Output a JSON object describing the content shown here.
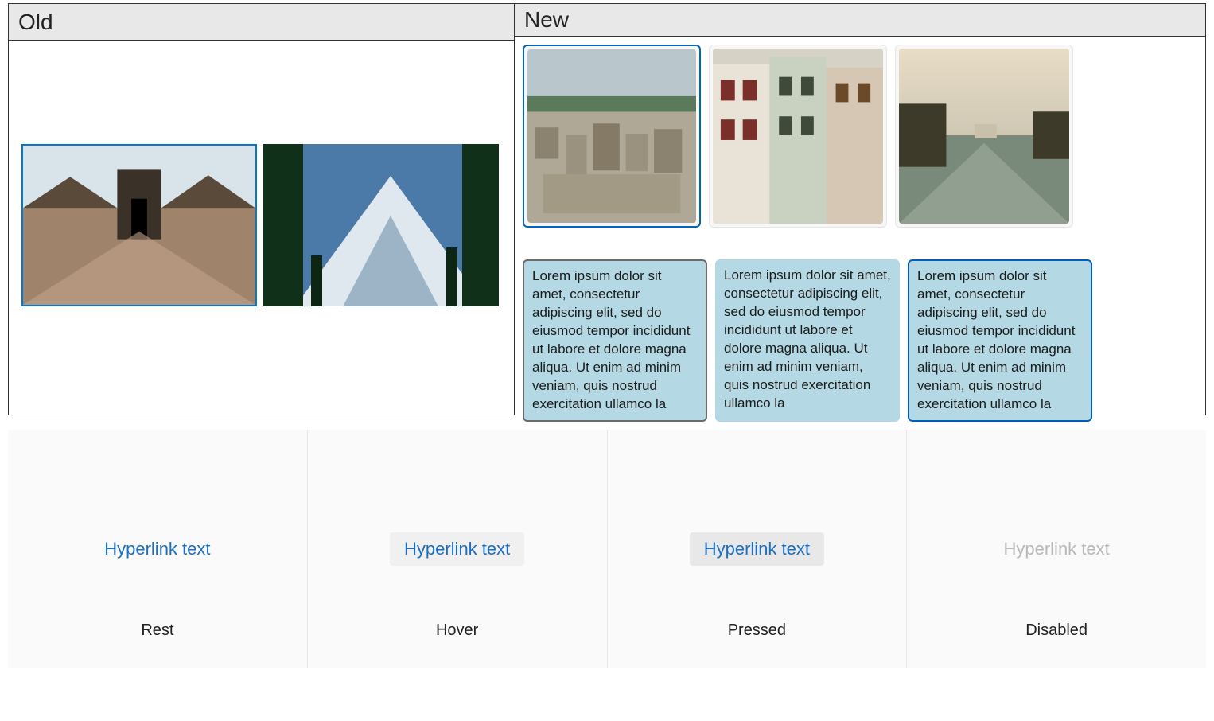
{
  "comparison": {
    "old_label": "Old",
    "new_label": "New",
    "old_images": [
      {
        "name": "fort-archway-photo",
        "selected": true
      },
      {
        "name": "snowy-mountain-photo",
        "selected": false
      }
    ],
    "new_thumbnails": [
      {
        "name": "cityscape-salzburg-photo",
        "selected": true
      },
      {
        "name": "european-townhouses-photo",
        "selected": false
      },
      {
        "name": "river-sunset-photo",
        "selected": false
      }
    ],
    "new_cards": [
      {
        "text": "Lorem ipsum dolor sit amet, consectetur adipiscing elit, sed do eiusmod tempor incididunt ut labore et dolore magna aliqua. Ut enim ad minim veniam, quis nostrud exercitation ullamco la",
        "variant": "a"
      },
      {
        "text": "Lorem ipsum dolor sit amet, consectetur adipiscing elit, sed do eiusmod tempor incididunt ut labore et dolore magna aliqua. Ut enim ad minim veniam, quis nostrud exercitation ullamco la",
        "variant": "b"
      },
      {
        "text": "Lorem ipsum dolor sit amet, consectetur adipiscing elit, sed do eiusmod tempor incididunt ut labore et dolore magna aliqua. Ut enim ad minim veniam, quis nostrud exercitation ullamco la",
        "variant": "c"
      }
    ]
  },
  "hyperlink_states": {
    "link_text": "Hyperlink text",
    "states": [
      {
        "key": "rest",
        "label": "Rest"
      },
      {
        "key": "hover",
        "label": "Hover"
      },
      {
        "key": "pressed",
        "label": "Pressed"
      },
      {
        "key": "disabled",
        "label": "Disabled"
      }
    ]
  }
}
